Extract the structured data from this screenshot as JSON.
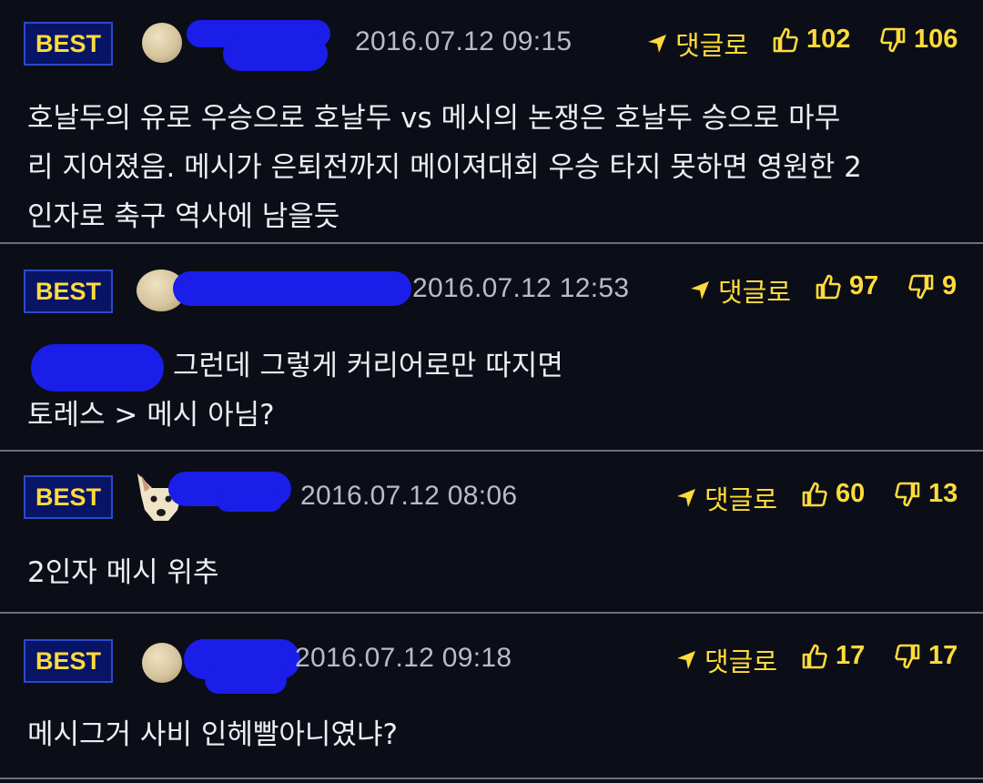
{
  "comments": [
    {
      "badge": "BEST",
      "time": "2016.07.12 09:15",
      "reply_label": "댓글로",
      "likes": "102",
      "dislikes": "106",
      "body": [
        "호날두의 유로 우승으로 호날두 vs 메시의 논쟁은 호날두 승으로 마무",
        "리 지어졌음. 메시가 은퇴전까지 메이져대회 우승 타지 못하면 영원한 2",
        "인자로 축구 역사에 남을듯"
      ]
    },
    {
      "badge": "BEST",
      "time": "2016.07.12 12:53",
      "reply_label": "댓글로",
      "likes": "97",
      "dislikes": "9",
      "body": [
        "그런데 그렇게 커리어로만 따지면",
        "토레스 > 메시 아님?"
      ]
    },
    {
      "badge": "BEST",
      "time": "2016.07.12 08:06",
      "reply_label": "댓글로",
      "likes": "60",
      "dislikes": "13",
      "body": [
        "2인자 메시 위추"
      ]
    },
    {
      "badge": "BEST",
      "time": "2016.07.12 09:18",
      "reply_label": "댓글로",
      "likes": "17",
      "dislikes": "17",
      "body": [
        "메시그거 사비 인헤빨아니였냐?"
      ]
    }
  ],
  "colors": {
    "background": "#0b0e17",
    "accent": "#ffdb3a",
    "badge_bg": "#081466",
    "text": "#eceef2",
    "time": "#b9bcc4"
  },
  "icons": {
    "reply": "arrow-icon",
    "like": "thumbs-up-icon",
    "dislike": "thumbs-down-icon"
  }
}
